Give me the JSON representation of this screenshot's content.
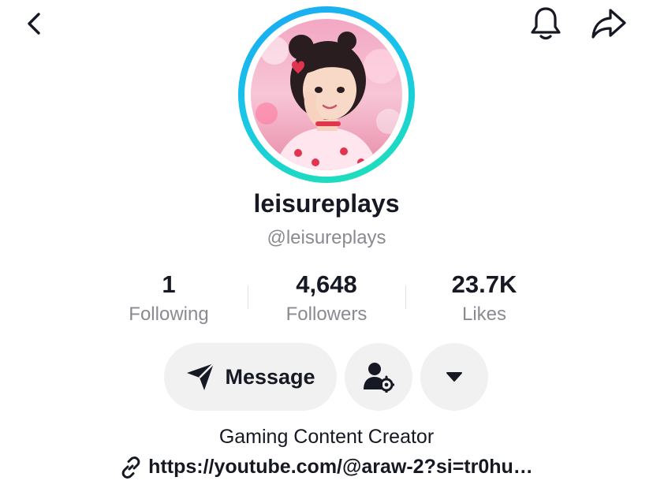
{
  "profile": {
    "display_name": "leisureplays",
    "handle": "@leisureplays",
    "bio": "Gaming Content Creator",
    "link": "https://youtube.com/@araw-2?si=tr0hu…"
  },
  "stats": {
    "following": {
      "value": "1",
      "label": "Following"
    },
    "followers": {
      "value": "4,648",
      "label": "Followers"
    },
    "likes": {
      "value": "23.7K",
      "label": "Likes"
    }
  },
  "actions": {
    "message_label": "Message"
  },
  "icons": {
    "back": "chevron-left-icon",
    "notifications": "bell-icon",
    "share": "share-arrow-icon",
    "message": "send-paper-plane-icon",
    "add_friend": "person-gear-icon",
    "more": "caret-down-icon",
    "link": "link-icon"
  },
  "colors": {
    "avatar_ring_start": "#1aa6f5",
    "avatar_ring_end": "#20e3b2",
    "button_bg": "#f1f1f2",
    "secondary_text": "#8a8b91",
    "primary_text": "#161823"
  }
}
